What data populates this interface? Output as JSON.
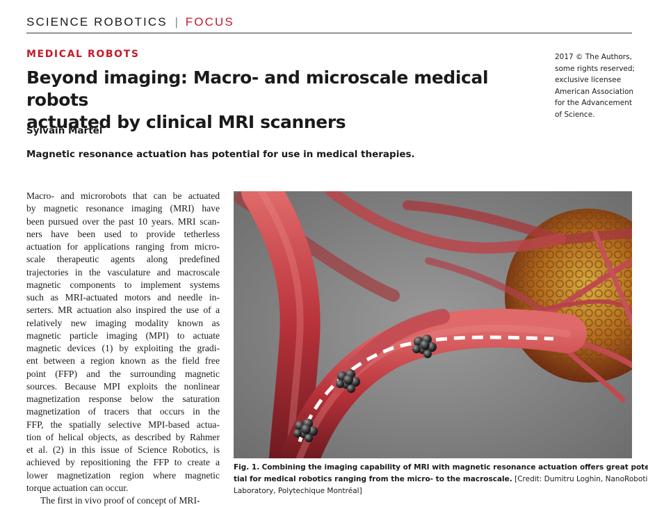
{
  "header": {
    "journal": "SCIENCE ROBOTICS",
    "separator": "|",
    "section": "FOCUS"
  },
  "article": {
    "category": "MEDICAL ROBOTS",
    "title_lines": [
      "Beyond imaging: Macro- and microscale medical robots",
      "actuated by clinical MRI scanners"
    ],
    "author": "Sylvain Martel",
    "summary": "Magnetic resonance actuation has potential for use in medical therapies."
  },
  "copyright_lines": [
    "2017 © The Authors,",
    "some rights reserved;",
    "exclusive licensee",
    "American Association",
    "for the Advancement",
    "of Science."
  ],
  "body_lines": [
    "Macro- and microrobots that can be actuated",
    "by magnetic resonance imaging (MRI) have",
    "been pursued over the past 10 years. MRI scan-",
    "ners have been used to provide tetherless",
    "actuation for applications ranging from micro-",
    "scale therapeutic agents along predefined",
    "trajectories in the vasculature and macroscale",
    "magnetic components to implement systems",
    "such as MRI-actuated motors and needle in-",
    "serters. MR actuation also inspired the use of a",
    "relatively new imaging modality known as",
    "magnetic particle imaging (MPI) to actuate",
    "magnetic devices (1) by exploiting the gradi-",
    "ent between a region known as the field free",
    "point (FFP) and the surrounding magnetic",
    "sources. Because MPI exploits the nonlinear",
    "magnetization response below the saturation",
    "magnetization of tracers that occurs in the",
    "FFP, the spatially selective MPI-based actua-",
    "tion of helical objects, as described by Rahmer",
    "et al. (2) in this issue of Science Robotics, is",
    "achieved by repositioning the FFP to create a",
    "lower magnetization region where magnetic",
    "torque actuation can occur.",
    "The first in vivo proof of concept of MRI-"
  ],
  "figure": {
    "caption_label": "Fig. 1.",
    "caption_bold_lines": [
      "Combining the imaging capability of MRI with magnetic resonance actuation offers great poten-",
      "tial for medical robotics ranging from the micro- to the macroscale."
    ],
    "caption_credit_a": "[Credit: Dumitru Loghin, NanoRobotics",
    "caption_credit_b": "Laboratory, Polytechique Montréal]"
  }
}
